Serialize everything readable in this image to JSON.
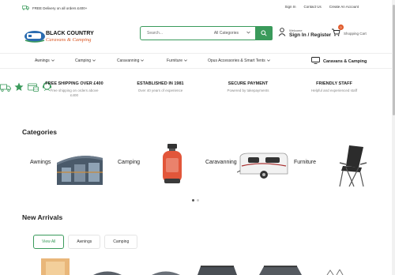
{
  "topbar": {
    "delivery_text": "FREE Delivery on all orders £400+",
    "links": [
      "Sign In",
      "Contact Us",
      "Create An Account"
    ]
  },
  "header": {
    "logo_text_top": "BLACK COUNTRY",
    "logo_text_bottom": "Caravans & Camping",
    "search_placeholder": "Search...",
    "search_category": "All Categories",
    "account_small": "Welcome",
    "account_big": "Sign In / Register",
    "cart_count": "0",
    "cart_label": "Shopping Cart"
  },
  "nav": {
    "items": [
      "Awnings",
      "Camping",
      "Caravanning",
      "Furniture",
      "Opus Accessories & Smart Tents"
    ],
    "featured": "Caravans & Camping"
  },
  "features": [
    {
      "title": "FREE SHIPPING OVER £400",
      "desc1": "Free shipping on orders above",
      "desc2": "£400",
      "icon": "truck-icon"
    },
    {
      "title": "ESTABLISHED IN 1981",
      "desc1": "Over 40 years of experience",
      "desc2": "",
      "icon": "star-icon"
    },
    {
      "title": "SECURE PAYMENT",
      "desc1": "Powered by takepayments",
      "desc2": "",
      "icon": "payment-icon"
    },
    {
      "title": "FRIENDLY STAFF",
      "desc1": "Helpful and experienced staff",
      "desc2": "",
      "icon": "staff-icon"
    }
  ],
  "categories": {
    "heading": "Categories",
    "items": [
      "Awnings",
      "Camping",
      "Caravanning",
      "Furniture"
    ]
  },
  "new_arrivals": {
    "heading": "New Arrivals",
    "tabs": [
      "View All",
      "Awnings",
      "Camping"
    ]
  },
  "colors": {
    "accent": "#3a9a5b",
    "badge": "#e05a2b"
  }
}
